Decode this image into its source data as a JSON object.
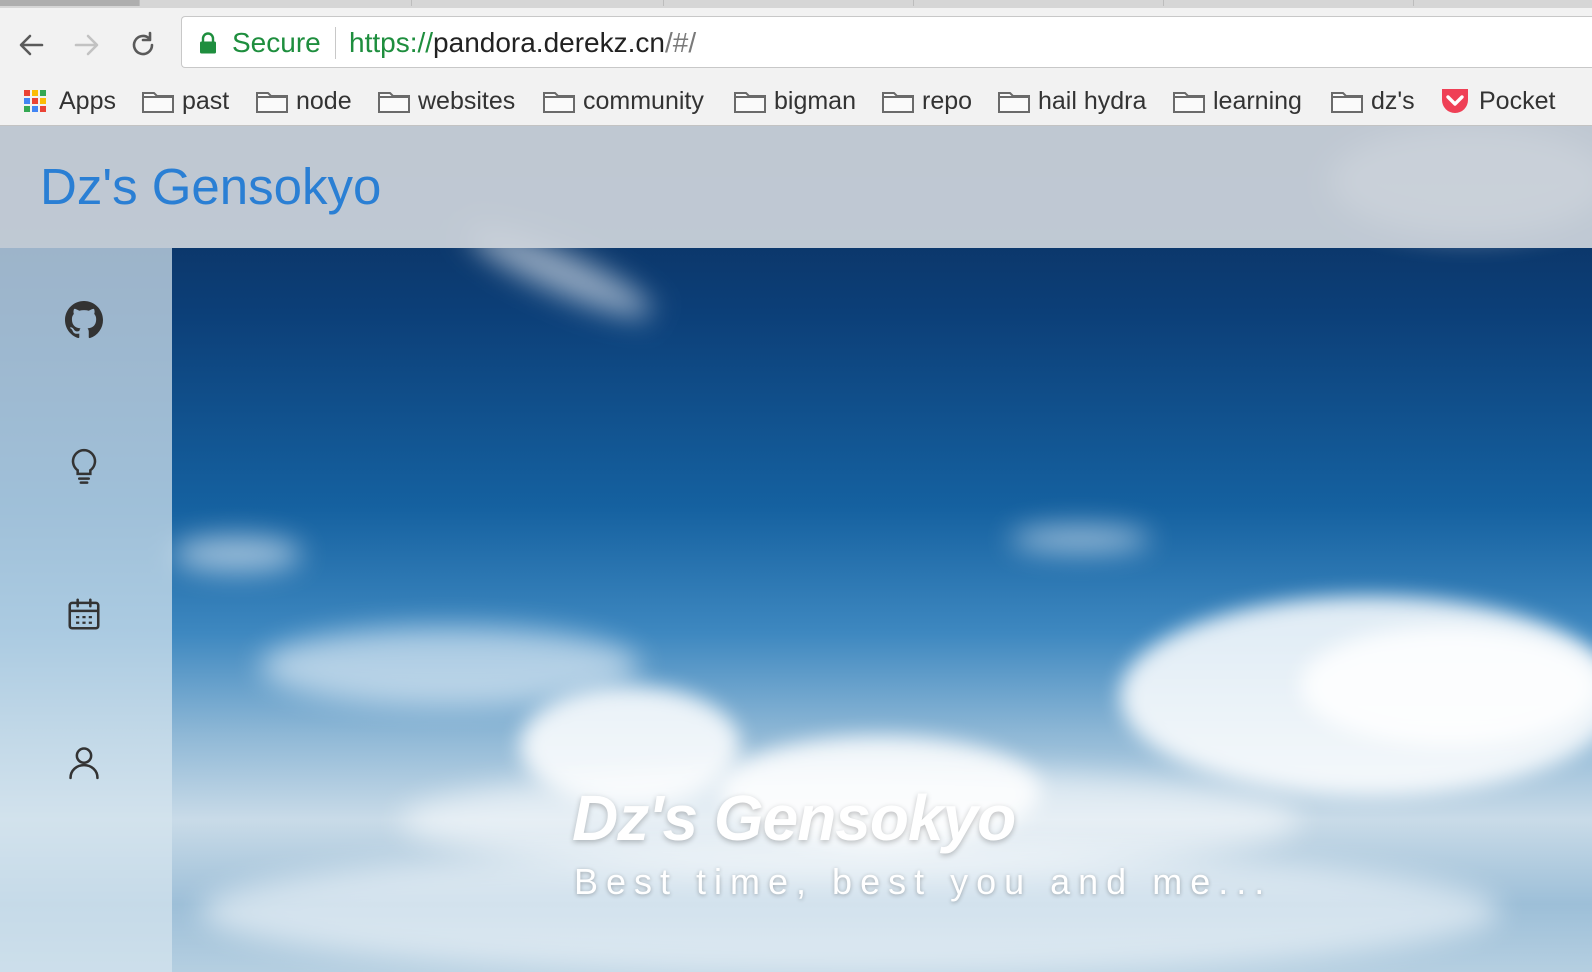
{
  "browser": {
    "secure_label": "Secure",
    "url_scheme": "https://",
    "url_host": "pandora.derekz.cn",
    "url_path": "/#/"
  },
  "bookmarks": [
    {
      "label": "Apps",
      "icon": "apps-grid-icon"
    },
    {
      "label": "past",
      "icon": "folder-icon"
    },
    {
      "label": "node",
      "icon": "folder-icon"
    },
    {
      "label": "websites",
      "icon": "folder-icon"
    },
    {
      "label": "community",
      "icon": "folder-icon"
    },
    {
      "label": "bigman",
      "icon": "folder-icon"
    },
    {
      "label": "repo",
      "icon": "folder-icon"
    },
    {
      "label": "hail hydra",
      "icon": "folder-icon"
    },
    {
      "label": "learning",
      "icon": "folder-icon"
    },
    {
      "label": "dz's",
      "icon": "folder-icon"
    },
    {
      "label": "Pocket",
      "icon": "pocket-icon"
    }
  ],
  "site": {
    "title": "Dz's Gensokyo",
    "title_color": "#2a7fd4"
  },
  "sidebar": {
    "items": [
      {
        "icon": "github-icon"
      },
      {
        "icon": "lightbulb-icon"
      },
      {
        "icon": "calendar-icon"
      },
      {
        "icon": "user-icon"
      }
    ]
  },
  "hero": {
    "title": "Dz's Gensokyo",
    "subtitle": "Best time, best you and me..."
  }
}
